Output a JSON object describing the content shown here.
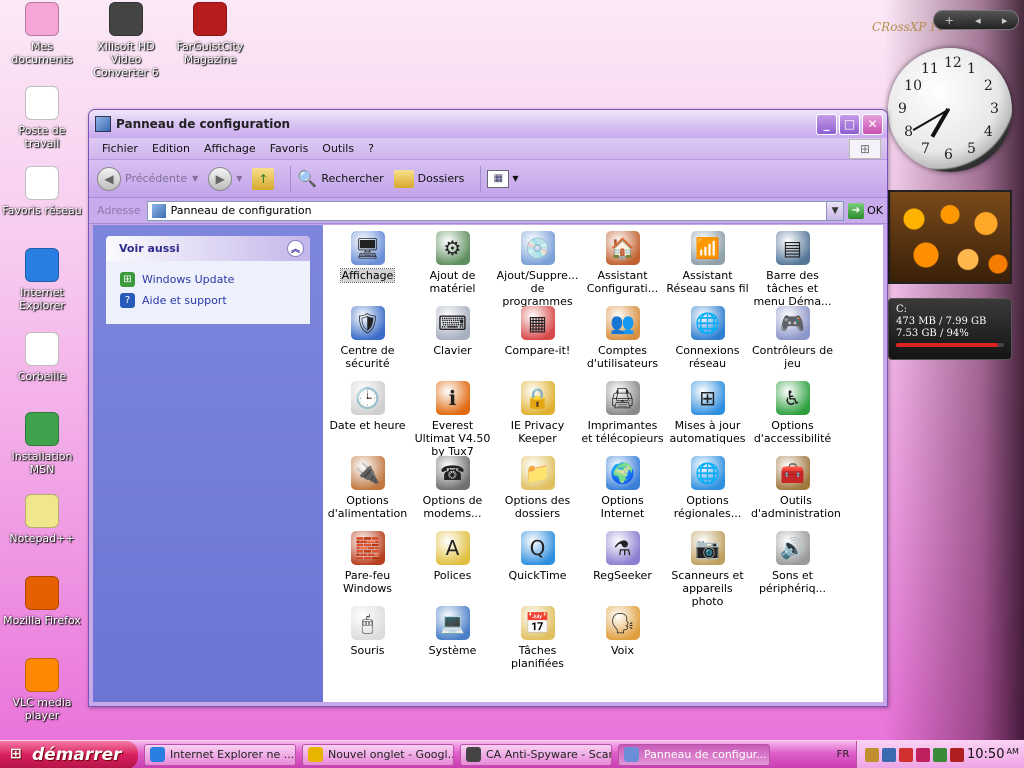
{
  "desktop": {
    "icons": [
      {
        "label": "Mes documents",
        "icon": "folder-icon",
        "color": "#f5a6d6"
      },
      {
        "label": "Xilisoft HD Video Converter 6",
        "icon": "film-reel-icon",
        "color": "#444444"
      },
      {
        "label": "FarGuistCity Magazine",
        "icon": "magazine-icon",
        "color": "#b71c1c"
      },
      {
        "label": "Poste de travail",
        "icon": "hello-kitty-icon",
        "color": "#ffffff"
      },
      {
        "label": "Favoris réseau",
        "icon": "hello-kitty-network-icon",
        "color": "#ffffff"
      },
      {
        "label": "Internet Explorer",
        "icon": "internet-explorer-icon",
        "color": "#2a7de1"
      },
      {
        "label": "Corbeille",
        "icon": "recycle-bin-icon",
        "color": "#ffffff"
      },
      {
        "label": "Installation MSN",
        "icon": "msn-icon",
        "color": "#3fa34d"
      },
      {
        "label": "Notepad++",
        "icon": "notepad-icon",
        "color": "#f0e68c"
      },
      {
        "label": "Mozilla Firefox",
        "icon": "firefox-icon",
        "color": "#e66000"
      },
      {
        "label": "VLC media player",
        "icon": "vlc-icon",
        "color": "#ff8800"
      }
    ]
  },
  "gadgets": {
    "brand": "CRossXP Pt",
    "bar": {
      "add": "+",
      "prev": "◂",
      "next": "▸"
    },
    "clock": {
      "numbers": [
        "12",
        "1",
        "2",
        "3",
        "4",
        "5",
        "6",
        "7",
        "8",
        "9",
        "10",
        "11"
      ]
    },
    "drive": {
      "name": "C:",
      "line1": "473 MB / 7.99 GB",
      "line2": "7.53 GB / 94%",
      "usage_percent": 94
    }
  },
  "window": {
    "title": "Panneau de configuration",
    "menu": [
      "Fichier",
      "Edition",
      "Affichage",
      "Favoris",
      "Outils",
      "?"
    ],
    "toolbar": {
      "back": "Précédente",
      "search": "Rechercher",
      "folders": "Dossiers"
    },
    "address": {
      "label": "Adresse",
      "value": "Panneau de configuration",
      "go": "OK"
    },
    "sidebar": {
      "see_also_title": "Voir aussi",
      "links": [
        {
          "label": "Windows Update",
          "icon": "windows-update-icon"
        },
        {
          "label": "Aide et support",
          "icon": "help-icon"
        }
      ]
    },
    "items": [
      {
        "label": "Affichage",
        "icon": "display-icon",
        "color": "#6a8fd8",
        "glyph": "🖥"
      },
      {
        "label": "Ajout de matériel",
        "icon": "add-hardware-icon",
        "color": "#5f8f5f",
        "glyph": "⚙"
      },
      {
        "label": "Ajout/Suppre... de programmes",
        "icon": "add-remove-programs-icon",
        "color": "#7aa0d8",
        "glyph": "💿"
      },
      {
        "label": "Assistant Configurati...",
        "icon": "network-setup-wizard-icon",
        "color": "#c0612f",
        "glyph": "🏠"
      },
      {
        "label": "Assistant Réseau sans fil",
        "icon": "wireless-network-icon",
        "color": "#8fa0a8",
        "glyph": "📶"
      },
      {
        "label": "Barre des tâches et menu Déma...",
        "icon": "taskbar-start-menu-icon",
        "color": "#557799",
        "glyph": "▤"
      },
      {
        "label": "Centre de sécurité",
        "icon": "security-center-icon",
        "color": "#3a6cc8",
        "glyph": "🛡"
      },
      {
        "label": "Clavier",
        "icon": "keyboard-icon",
        "color": "#a8b0c0",
        "glyph": "⌨"
      },
      {
        "label": "Compare-it!",
        "icon": "compare-it-icon",
        "color": "#d84a4a",
        "glyph": "▦"
      },
      {
        "label": "Comptes d'utilisateurs",
        "icon": "user-accounts-icon",
        "color": "#d89040",
        "glyph": "👥"
      },
      {
        "label": "Connexions réseau",
        "icon": "network-connections-icon",
        "color": "#2f7fd0",
        "glyph": "🌐"
      },
      {
        "label": "Contrôleurs de jeu",
        "icon": "game-controller-icon",
        "color": "#8c96c8",
        "glyph": "🎮"
      },
      {
        "label": "Date et heure",
        "icon": "date-time-icon",
        "color": "#cfcfcf",
        "glyph": "🕒"
      },
      {
        "label": "Everest Ultimat V4.50 by Tux7",
        "icon": "everest-icon",
        "color": "#e06a10",
        "glyph": "ℹ"
      },
      {
        "label": "IE Privacy Keeper",
        "icon": "ie-privacy-keeper-icon",
        "color": "#e0b030",
        "glyph": "🔒"
      },
      {
        "label": "Imprimantes et télécopieurs",
        "icon": "printers-icon",
        "color": "#8a8a8a",
        "glyph": "🖨"
      },
      {
        "label": "Mises à jour automatiques",
        "icon": "automatic-updates-icon",
        "color": "#2f8fdf",
        "glyph": "⊞"
      },
      {
        "label": "Options d'accessibilité",
        "icon": "accessibility-icon",
        "color": "#2fa040",
        "glyph": "♿"
      },
      {
        "label": "Options d'alimentation",
        "icon": "power-options-icon",
        "color": "#c07840",
        "glyph": "🔌"
      },
      {
        "label": "Options de modems...",
        "icon": "modem-options-icon",
        "color": "#707070",
        "glyph": "☎"
      },
      {
        "label": "Options des dossiers",
        "icon": "folder-options-icon",
        "color": "#e0c060",
        "glyph": "📁"
      },
      {
        "label": "Options Internet",
        "icon": "internet-options-icon",
        "color": "#3a7fd8",
        "glyph": "🌍"
      },
      {
        "label": "Options régionales...",
        "icon": "regional-options-icon",
        "color": "#2f8fdf",
        "glyph": "🌐"
      },
      {
        "label": "Outils d'administration",
        "icon": "admin-tools-icon",
        "color": "#a07840",
        "glyph": "🧰"
      },
      {
        "label": "Pare-feu Windows",
        "icon": "firewall-icon",
        "color": "#b84020",
        "glyph": "🧱"
      },
      {
        "label": "Polices",
        "icon": "fonts-icon",
        "color": "#e0c040",
        "glyph": "A"
      },
      {
        "label": "QuickTime",
        "icon": "quicktime-icon",
        "color": "#2f8fdf",
        "glyph": "Q"
      },
      {
        "label": "RegSeeker",
        "icon": "regseeker-icon",
        "color": "#8a7fd0",
        "glyph": "⚗"
      },
      {
        "label": "Scanneurs et appareils photo",
        "icon": "scanners-cameras-icon",
        "color": "#c0a060",
        "glyph": "📷"
      },
      {
        "label": "Sons et périphériq...",
        "icon": "sounds-icon",
        "color": "#9a9a9a",
        "glyph": "🔊"
      },
      {
        "label": "Souris",
        "icon": "mouse-icon",
        "color": "#dcdcdc",
        "glyph": "🖱"
      },
      {
        "label": "Système",
        "icon": "system-icon",
        "color": "#4a7fc8",
        "glyph": "💻"
      },
      {
        "label": "Tâches planifiées",
        "icon": "scheduled-tasks-icon",
        "color": "#e0c060",
        "glyph": "📅"
      },
      {
        "label": "Voix",
        "icon": "speech-icon",
        "color": "#e0a040",
        "glyph": "🗣"
      }
    ],
    "selected_index": 0
  },
  "taskbar": {
    "start_label": "démarrer",
    "tasks": [
      {
        "label": "Internet Explorer ne ...",
        "icon": "internet-explorer-icon",
        "color": "#2a7de1"
      },
      {
        "label": "Nouvel onglet - Googl...",
        "icon": "chrome-icon",
        "color": "#e8b400"
      },
      {
        "label": "CA Anti-Spyware - Scan",
        "icon": "ca-antispyware-icon",
        "color": "#444444"
      },
      {
        "label": "Panneau de configur...",
        "icon": "control-panel-icon",
        "color": "#6a8fd8",
        "active": true
      }
    ],
    "language": "FR",
    "tray_icons": [
      "security-tray-icon",
      "network-tray-icon",
      "antivirus-tray-icon",
      "update-tray-icon",
      "safely-remove-tray-icon",
      "shield-tray-icon"
    ],
    "clock_time": "10:50",
    "clock_ampm": "AM"
  }
}
